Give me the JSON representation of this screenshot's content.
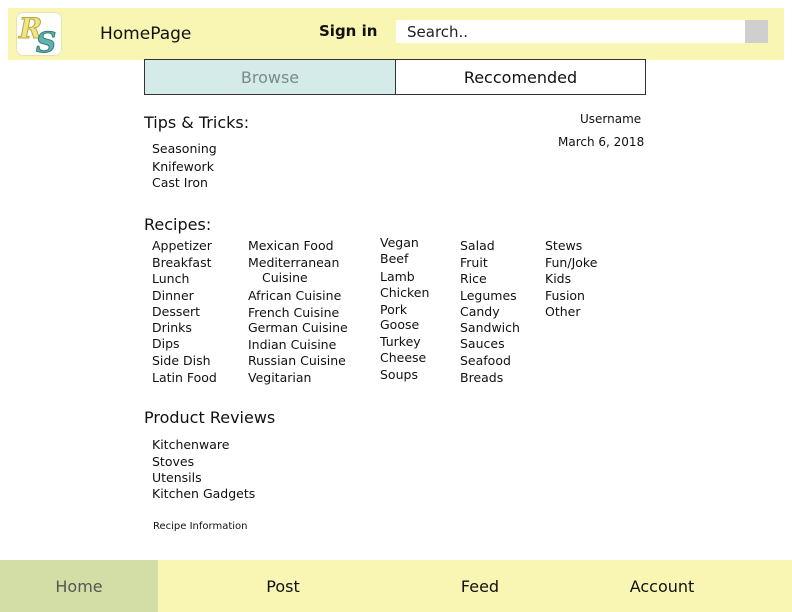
{
  "header": {
    "logo_letters": [
      "R",
      "S"
    ],
    "title": "HomePage",
    "sign_in": "Sign in",
    "search_placeholder": "Search.."
  },
  "tabs": {
    "browse": "Browse",
    "recommended": "Reccomended"
  },
  "user": {
    "username": "Username",
    "date": "March 6, 2018"
  },
  "tips": {
    "title": "Tips & Tricks:",
    "items": [
      "Seasoning",
      "Knifework",
      "Cast Iron"
    ]
  },
  "recipes": {
    "title": "Recipes:",
    "col1": [
      "Appetizer",
      "Breakfast",
      "Lunch",
      "Dinner",
      "Dessert",
      "Drinks",
      "Dips",
      "Side Dish",
      "Latin Food"
    ],
    "col2": [
      "Mexican Food",
      "Mediterranean",
      "Cuisine",
      "African Cuisine",
      "French Cuisine",
      "German Cuisine",
      "Indian Cuisine",
      "Russian Cuisine",
      "Vegitarian"
    ],
    "col3": [
      "Vegan",
      "Beef",
      "Lamb",
      "Chicken",
      "Pork",
      "Goose",
      "Turkey",
      "Cheese",
      "Soups"
    ],
    "col4": [
      "Salad",
      "Fruit",
      "Rice",
      "Legumes",
      "Candy",
      "Sandwich",
      "Sauces",
      "Seafood",
      "Breads"
    ],
    "col5": [
      "Stews",
      "Fun/Joke",
      "Kids",
      "Fusion",
      "Other"
    ]
  },
  "reviews": {
    "title": "Product Reviews",
    "items": [
      "Kitchenware",
      "Stoves",
      "Utensils",
      "Kitchen Gadgets"
    ]
  },
  "footer_note": "Recipe Information",
  "bottom_nav": {
    "home": "Home",
    "post": "Post",
    "feed": "Feed",
    "account": "Account"
  },
  "colors": {
    "header_bg": "#f9f5b2",
    "tab_active_bg": "#d5ebe9",
    "nav_active_bg": "#d3dea6"
  }
}
